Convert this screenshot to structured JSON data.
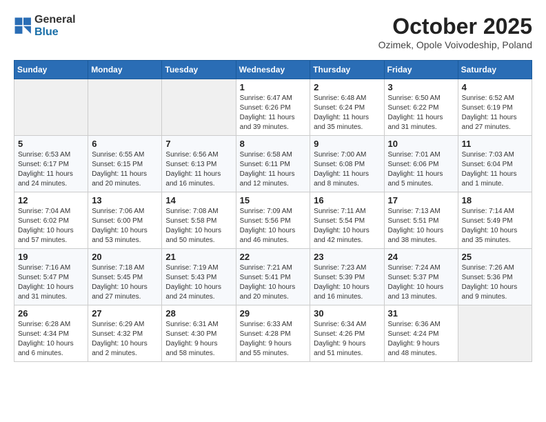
{
  "header": {
    "logo_general": "General",
    "logo_blue": "Blue",
    "month_title": "October 2025",
    "subtitle": "Ozimek, Opole Voivodeship, Poland"
  },
  "weekdays": [
    "Sunday",
    "Monday",
    "Tuesday",
    "Wednesday",
    "Thursday",
    "Friday",
    "Saturday"
  ],
  "weeks": [
    [
      {
        "day": "",
        "info": ""
      },
      {
        "day": "",
        "info": ""
      },
      {
        "day": "",
        "info": ""
      },
      {
        "day": "1",
        "info": "Sunrise: 6:47 AM\nSunset: 6:26 PM\nDaylight: 11 hours\nand 39 minutes."
      },
      {
        "day": "2",
        "info": "Sunrise: 6:48 AM\nSunset: 6:24 PM\nDaylight: 11 hours\nand 35 minutes."
      },
      {
        "day": "3",
        "info": "Sunrise: 6:50 AM\nSunset: 6:22 PM\nDaylight: 11 hours\nand 31 minutes."
      },
      {
        "day": "4",
        "info": "Sunrise: 6:52 AM\nSunset: 6:19 PM\nDaylight: 11 hours\nand 27 minutes."
      }
    ],
    [
      {
        "day": "5",
        "info": "Sunrise: 6:53 AM\nSunset: 6:17 PM\nDaylight: 11 hours\nand 24 minutes."
      },
      {
        "day": "6",
        "info": "Sunrise: 6:55 AM\nSunset: 6:15 PM\nDaylight: 11 hours\nand 20 minutes."
      },
      {
        "day": "7",
        "info": "Sunrise: 6:56 AM\nSunset: 6:13 PM\nDaylight: 11 hours\nand 16 minutes."
      },
      {
        "day": "8",
        "info": "Sunrise: 6:58 AM\nSunset: 6:11 PM\nDaylight: 11 hours\nand 12 minutes."
      },
      {
        "day": "9",
        "info": "Sunrise: 7:00 AM\nSunset: 6:08 PM\nDaylight: 11 hours\nand 8 minutes."
      },
      {
        "day": "10",
        "info": "Sunrise: 7:01 AM\nSunset: 6:06 PM\nDaylight: 11 hours\nand 5 minutes."
      },
      {
        "day": "11",
        "info": "Sunrise: 7:03 AM\nSunset: 6:04 PM\nDaylight: 11 hours\nand 1 minute."
      }
    ],
    [
      {
        "day": "12",
        "info": "Sunrise: 7:04 AM\nSunset: 6:02 PM\nDaylight: 10 hours\nand 57 minutes."
      },
      {
        "day": "13",
        "info": "Sunrise: 7:06 AM\nSunset: 6:00 PM\nDaylight: 10 hours\nand 53 minutes."
      },
      {
        "day": "14",
        "info": "Sunrise: 7:08 AM\nSunset: 5:58 PM\nDaylight: 10 hours\nand 50 minutes."
      },
      {
        "day": "15",
        "info": "Sunrise: 7:09 AM\nSunset: 5:56 PM\nDaylight: 10 hours\nand 46 minutes."
      },
      {
        "day": "16",
        "info": "Sunrise: 7:11 AM\nSunset: 5:54 PM\nDaylight: 10 hours\nand 42 minutes."
      },
      {
        "day": "17",
        "info": "Sunrise: 7:13 AM\nSunset: 5:51 PM\nDaylight: 10 hours\nand 38 minutes."
      },
      {
        "day": "18",
        "info": "Sunrise: 7:14 AM\nSunset: 5:49 PM\nDaylight: 10 hours\nand 35 minutes."
      }
    ],
    [
      {
        "day": "19",
        "info": "Sunrise: 7:16 AM\nSunset: 5:47 PM\nDaylight: 10 hours\nand 31 minutes."
      },
      {
        "day": "20",
        "info": "Sunrise: 7:18 AM\nSunset: 5:45 PM\nDaylight: 10 hours\nand 27 minutes."
      },
      {
        "day": "21",
        "info": "Sunrise: 7:19 AM\nSunset: 5:43 PM\nDaylight: 10 hours\nand 24 minutes."
      },
      {
        "day": "22",
        "info": "Sunrise: 7:21 AM\nSunset: 5:41 PM\nDaylight: 10 hours\nand 20 minutes."
      },
      {
        "day": "23",
        "info": "Sunrise: 7:23 AM\nSunset: 5:39 PM\nDaylight: 10 hours\nand 16 minutes."
      },
      {
        "day": "24",
        "info": "Sunrise: 7:24 AM\nSunset: 5:37 PM\nDaylight: 10 hours\nand 13 minutes."
      },
      {
        "day": "25",
        "info": "Sunrise: 7:26 AM\nSunset: 5:36 PM\nDaylight: 10 hours\nand 9 minutes."
      }
    ],
    [
      {
        "day": "26",
        "info": "Sunrise: 6:28 AM\nSunset: 4:34 PM\nDaylight: 10 hours\nand 6 minutes."
      },
      {
        "day": "27",
        "info": "Sunrise: 6:29 AM\nSunset: 4:32 PM\nDaylight: 10 hours\nand 2 minutes."
      },
      {
        "day": "28",
        "info": "Sunrise: 6:31 AM\nSunset: 4:30 PM\nDaylight: 9 hours\nand 58 minutes."
      },
      {
        "day": "29",
        "info": "Sunrise: 6:33 AM\nSunset: 4:28 PM\nDaylight: 9 hours\nand 55 minutes."
      },
      {
        "day": "30",
        "info": "Sunrise: 6:34 AM\nSunset: 4:26 PM\nDaylight: 9 hours\nand 51 minutes."
      },
      {
        "day": "31",
        "info": "Sunrise: 6:36 AM\nSunset: 4:24 PM\nDaylight: 9 hours\nand 48 minutes."
      },
      {
        "day": "",
        "info": ""
      }
    ]
  ]
}
